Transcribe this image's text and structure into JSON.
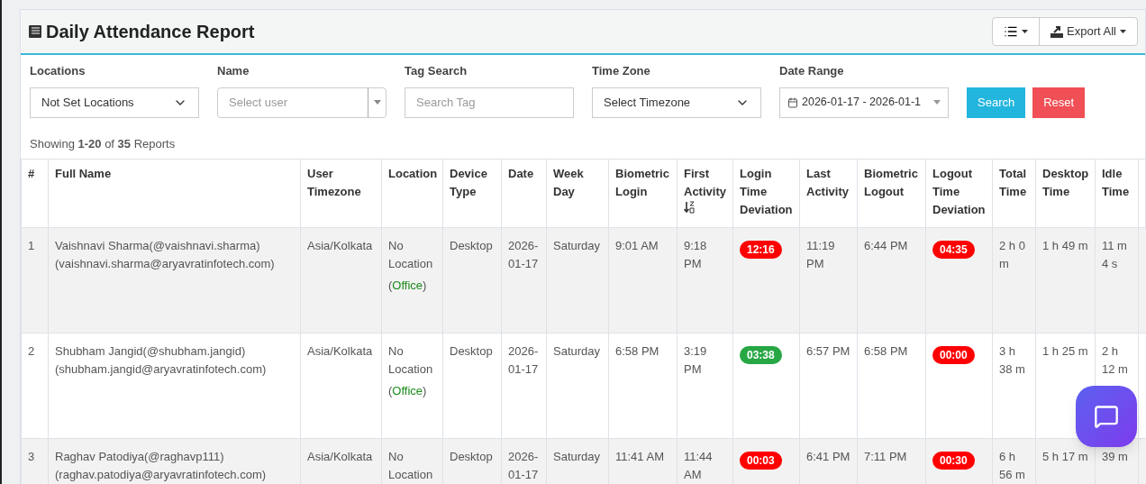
{
  "header": {
    "title": "Daily Attendance Report",
    "export_label": "Export All"
  },
  "filters": [
    {
      "kind": "select",
      "label": "Locations",
      "value": "Not Set Locations"
    },
    {
      "kind": "combo",
      "label": "Name",
      "placeholder": "Select user"
    },
    {
      "kind": "text",
      "label": "Tag Search",
      "placeholder": "Search Tag"
    },
    {
      "kind": "select",
      "label": "Time Zone",
      "value": "Select Timezone"
    },
    {
      "kind": "date",
      "label": "Date Range",
      "value": "2026-01-17 - 2026-01-1"
    }
  ],
  "buttons": {
    "search": "Search",
    "reset": "Reset"
  },
  "summary": "Showing **1-20** of **35** Reports",
  "table": {
    "columns": [
      {
        "label": "#",
        "sorted": false
      },
      {
        "label": "Full Name",
        "sorted": false
      },
      {
        "label": "User Timezone",
        "sorted": false
      },
      {
        "label": "Location",
        "sorted": false
      },
      {
        "label": "Device Type",
        "sorted": false
      },
      {
        "label": "Date",
        "sorted": false
      },
      {
        "label": "Week Day",
        "sorted": false
      },
      {
        "label": "Biometric Login",
        "sorted": false
      },
      {
        "label": "First Activity",
        "sorted": true
      },
      {
        "label": "Login Time Deviation",
        "sorted": false
      },
      {
        "label": "Last Activity",
        "sorted": false
      },
      {
        "label": "Biometric Logout",
        "sorted": false
      },
      {
        "label": "Logout Time Deviation",
        "sorted": false
      },
      {
        "label": "Total Time",
        "sorted": false
      },
      {
        "label": "Desktop Time",
        "sorted": false
      },
      {
        "label": "Idle Time",
        "sorted": false
      }
    ],
    "rows": [
      {
        "num": "1",
        "name": "Vaishnavi Sharma(@vaishnavi.sharma)",
        "email": "(vaishnavi.sharma@aryavratinfotech.com)",
        "timezone": "Asia/Kolkata",
        "location": "No Location",
        "location_tag": {
          "open": "(",
          "label": "Office",
          "close": ")"
        },
        "device": "Desktop",
        "date": "2026-01-17",
        "weekday": "Saturday",
        "bio_login": "9:01 AM",
        "first_activity": "9:18 PM",
        "login_dev": {
          "text": "12:16",
          "color": "#ff0000"
        },
        "last_activity": "11:19 PM",
        "bio_logout": "6:44 PM",
        "logout_dev": {
          "text": "04:35",
          "color": "#ff0000"
        },
        "total": "2 h 0 m",
        "desktop": "1 h 49 m",
        "idle": "11 m 4 s"
      },
      {
        "num": "2",
        "name": "Shubham Jangid(@shubham.jangid)",
        "email": "(shubham.jangid@aryavratinfotech.com)",
        "timezone": "Asia/Kolkata",
        "location": "No Location",
        "location_tag": {
          "open": "(",
          "label": "Office",
          "close": ")"
        },
        "device": "Desktop",
        "date": "2026-01-17",
        "weekday": "Saturday",
        "bio_login": "6:58 PM",
        "first_activity": "3:19 PM",
        "login_dev": {
          "text": "03:38",
          "color": "#28a745"
        },
        "last_activity": "6:57 PM",
        "bio_logout": "6:58 PM",
        "logout_dev": {
          "text": "00:00",
          "color": "#ff0000"
        },
        "total": "3 h 38 m",
        "desktop": "1 h 25 m",
        "idle": "2 h 12 m"
      },
      {
        "num": "3",
        "name": "Raghav Patodiya(@raghavp111)",
        "email": "(raghav.patodiya@aryavratinfotech.com)",
        "timezone": "Asia/Kolkata",
        "location": "No Location",
        "device": "Desktop",
        "date": "2026-01-17",
        "weekday": "Saturday",
        "bio_login": "11:41 AM",
        "first_activity": "11:44 AM",
        "login_dev": {
          "text": "00:03",
          "color": "#ff0000"
        },
        "last_activity": "6:41 PM",
        "bio_logout": "7:11 PM",
        "logout_dev": {
          "text": "00:30",
          "color": "#ff0000"
        },
        "total": "6 h 56 m",
        "desktop": "5 h 17 m",
        "idle": "39 m"
      }
    ]
  }
}
